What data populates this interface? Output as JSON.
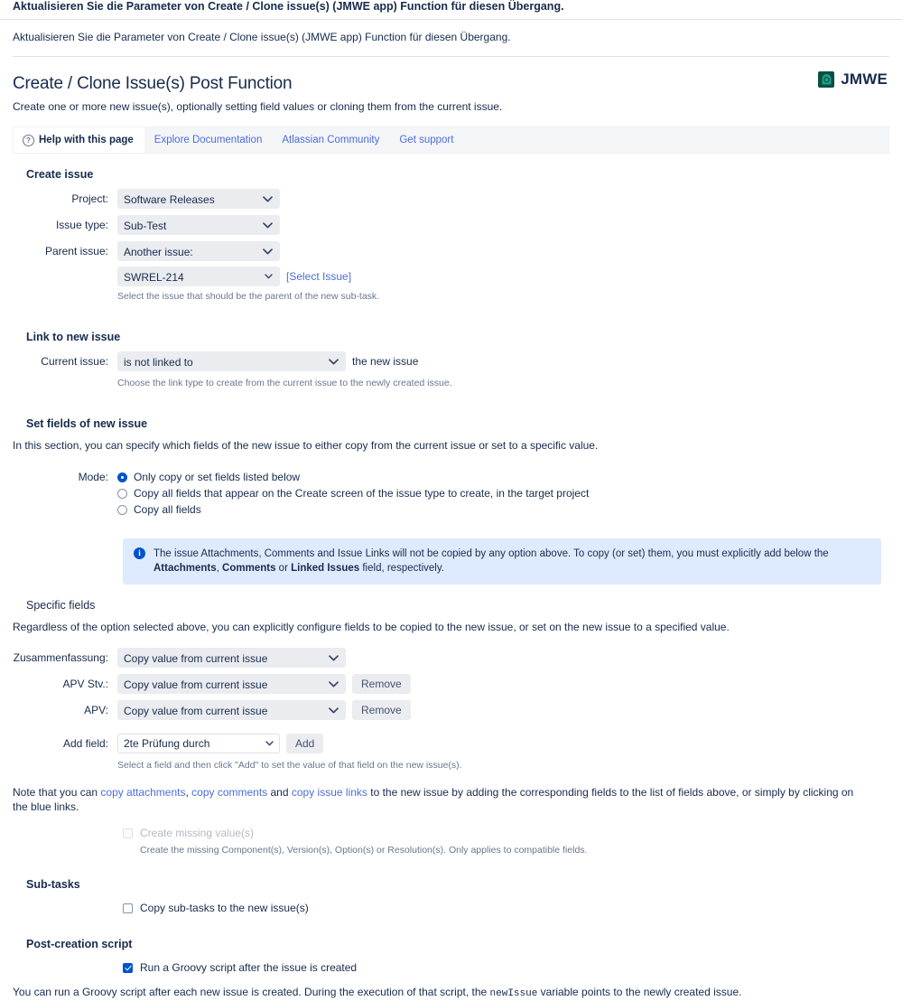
{
  "dialog": {
    "title": "Aktualisieren Sie die Parameter von Create / Clone issue(s) (JMWE app) Function für diesen Übergang.",
    "subtitle": "Aktualisieren Sie die Parameter von Create / Clone issue(s) (JMWE app) Function für diesen Übergang."
  },
  "page": {
    "title": "Create / Clone Issue(s) Post Function",
    "description": "Create one or more new issue(s), optionally setting field values or cloning them from the current issue.",
    "brand": "JMWE"
  },
  "helpbar": {
    "help_tab": "Help with this page",
    "links": [
      "Explore Documentation",
      "Atlassian Community",
      "Get support"
    ]
  },
  "create_issue": {
    "heading": "Create issue",
    "project": {
      "label": "Project:",
      "value": "Software Releases"
    },
    "issue_type": {
      "label": "Issue type:",
      "value": "Sub-Test"
    },
    "parent_issue": {
      "label": "Parent issue:",
      "value": "Another issue:"
    },
    "parent_key": {
      "value": "SWREL-214",
      "select_link": "[Select Issue]"
    },
    "parent_hint": "Select the issue that should be the parent of the new sub-task."
  },
  "link_new_issue": {
    "heading": "Link to new issue",
    "current_issue_label": "Current issue:",
    "link_type": "is not linked to",
    "after_text": "the new issue",
    "hint": "Choose the link type to create from the current issue to the newly created issue."
  },
  "set_fields": {
    "heading": "Set fields of new issue",
    "description": "In this section, you can specify which fields of the new issue to either copy from the current issue or set to a specific value.",
    "mode_label": "Mode:",
    "modes": [
      {
        "label": "Only copy or set fields listed below",
        "selected": true
      },
      {
        "label": "Copy all fields that appear on the Create screen of the issue type to create, in the target project",
        "selected": false
      },
      {
        "label": "Copy all fields",
        "selected": false
      }
    ],
    "info": {
      "part1": "The issue Attachments, Comments and Issue Links will not be copied by any option above. To copy (or set) them, you must explicitly add below the ",
      "bold1": "Attachments",
      "part2": ", ",
      "bold2": "Comments",
      "part3": " or ",
      "bold3": "Linked Issues",
      "part4": " field, respectively."
    }
  },
  "specific_fields": {
    "heading": "Specific fields",
    "description": "Regardless of the option selected above, you can explicitly configure fields to be copied to the new issue, or set on the new issue to a specified value.",
    "rows": [
      {
        "label": "Zusammenfassung:",
        "value": "Copy value from current issue",
        "remove": null
      },
      {
        "label": "APV Stv.:",
        "value": "Copy value from current issue",
        "remove": "Remove"
      },
      {
        "label": "APV:",
        "value": "Copy value from current issue",
        "remove": "Remove"
      }
    ],
    "add_field": {
      "label": "Add field:",
      "value": "2te Prüfung durch",
      "button": "Add",
      "hint": "Select a field and then click \"Add\" to set the value of that field on the new issue(s)."
    },
    "note": {
      "pre": "Note that you can ",
      "link1": "copy attachments",
      "mid1": ",  ",
      "link2": "copy comments",
      "mid2": " and  ",
      "link3": "copy issue links",
      "post": " to the new issue by adding the corresponding fields to the list of fields above, or simply by clicking on the blue links."
    },
    "create_missing": {
      "label": "Create missing value(s)",
      "checked": false,
      "disabled": true,
      "hint": "Create the missing Component(s), Version(s), Option(s) or Resolution(s). Only applies to compatible fields."
    }
  },
  "sub_tasks": {
    "heading": "Sub-tasks",
    "copy_label": "Copy sub-tasks to the new issue(s)",
    "checked": false
  },
  "post_creation": {
    "heading": "Post-creation script",
    "run_label": "Run a Groovy script after the issue is created",
    "checked": true,
    "desc_pre": "You can run a Groovy script after each new issue is created. During the execution of that script, the ",
    "desc_mono": "newIssue",
    "desc_post": " variable points to the newly created issue."
  },
  "colors": {
    "link": "#4C6EDB",
    "accent": "#0052CC",
    "info_bg": "#DEEBFF",
    "control_bg": "#EBECF0",
    "brand_logo": "#0B4F43"
  }
}
